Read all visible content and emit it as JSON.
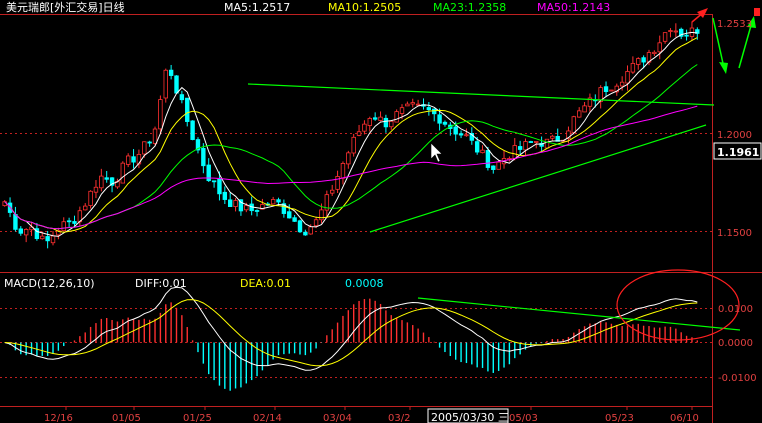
{
  "header": {
    "title": "美元瑞郎[外汇交易]日线",
    "ma": [
      {
        "label": "MA5:1.2517",
        "color": "#ffffff"
      },
      {
        "label": "MA10:1.2505",
        "color": "#ffff00"
      },
      {
        "label": "MA23:1.2358",
        "color": "#00ff00"
      },
      {
        "label": "MA50:1.2143",
        "color": "#ff00ff"
      }
    ]
  },
  "price_axis": {
    "ticks": [
      "1.2533",
      "1.2000",
      "1.1500"
    ],
    "current_label": "1.1961"
  },
  "macd_header": {
    "name": "MACD(12,26,10)",
    "diff": "DIFF:0.01",
    "dea": "DEA:0.01",
    "macd": "0.0008"
  },
  "macd_axis": {
    "ticks": [
      "0.0100",
      "0.0000",
      "-0.0100"
    ]
  },
  "date_axis": {
    "ticks": [
      "12/16",
      "01/05",
      "01/25",
      "02/14",
      "03/04",
      "03/2",
      "05/03",
      "05/23",
      "06/10"
    ],
    "cursor_label": "2005/03/30 三"
  },
  "colors": {
    "up": "#ff3030",
    "down": "#00ffff",
    "ma5": "#ffffff",
    "ma10": "#ffff00",
    "ma23": "#00ff00",
    "ma50": "#ff00ff",
    "trend": "#00ff00",
    "axis": "#c02020"
  },
  "chart_data": [
    {
      "type": "candlestick",
      "title": "美元瑞郎[外汇交易]日线",
      "ylim": [
        1.135,
        1.262
      ],
      "y_ticks": [
        1.15,
        1.2
      ],
      "x_labels": [
        "12/16",
        "01/05",
        "01/25",
        "02/14",
        "03/04",
        "03/2",
        "05/03",
        "05/23",
        "06/10"
      ],
      "close_keypoints": [
        1.165,
        1.15,
        1.152,
        1.143,
        1.152,
        1.155,
        1.165,
        1.178,
        1.175,
        1.185,
        1.19,
        1.2,
        1.236,
        1.215,
        1.195,
        1.178,
        1.168,
        1.163,
        1.16,
        1.163,
        1.165,
        1.158,
        1.15,
        1.155,
        1.17,
        1.186,
        1.2,
        1.21,
        1.205,
        1.21,
        1.213,
        1.212,
        1.208,
        1.202,
        1.198,
        1.19,
        1.182,
        1.189,
        1.192,
        1.196,
        1.195,
        1.198,
        1.208,
        1.215,
        1.222,
        1.226,
        1.232,
        1.238,
        1.245,
        1.255,
        1.25,
        1.253
      ],
      "series": [
        {
          "name": "MA5:1.2517",
          "last": 1.2517
        },
        {
          "name": "MA10:1.2505",
          "last": 1.2505
        },
        {
          "name": "MA23:1.2358",
          "last": 1.2358
        },
        {
          "name": "MA50:1.2143",
          "last": 1.2143
        }
      ],
      "current_price": 1.1961
    },
    {
      "type": "bar",
      "title": "MACD(12,26,10)",
      "ylim": [
        -0.013,
        0.017
      ],
      "y_ticks": [
        0.01,
        0.0,
        -0.01
      ],
      "series": [
        {
          "name": "DIFF:0.01",
          "last": 0.01
        },
        {
          "name": "DEA:0.01",
          "last": 0.01
        },
        {
          "name": "MACD",
          "last": 0.0008
        }
      ]
    }
  ]
}
